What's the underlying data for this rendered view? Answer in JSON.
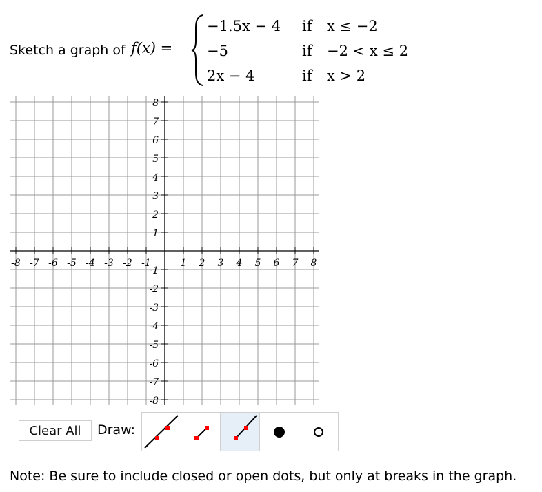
{
  "question": {
    "prompt": "Sketch a graph of",
    "function_label": "f(x) =",
    "cases": [
      {
        "expr": "−1.5x − 4",
        "if": "if",
        "cond": "x ≤ −2"
      },
      {
        "expr": "−5",
        "if": "if",
        "cond": "−2 < x ≤ 2"
      },
      {
        "expr": "2x − 4",
        "if": "if",
        "cond": "x > 2"
      }
    ]
  },
  "graph": {
    "x_range": [
      -8,
      8
    ],
    "y_range": [
      -8,
      8
    ],
    "x_ticks": [
      "-8",
      "-7",
      "-6",
      "-5",
      "-4",
      "-3",
      "-2",
      "-1",
      "1",
      "2",
      "3",
      "4",
      "5",
      "6",
      "7",
      "8"
    ],
    "y_ticks": [
      "8",
      "7",
      "6",
      "5",
      "4",
      "3",
      "2",
      "1",
      "-1",
      "-2",
      "-3",
      "-4",
      "-5",
      "-6",
      "-7",
      "-8"
    ],
    "grid_color": "#999999",
    "axis_color": "#000000"
  },
  "toolbar": {
    "clear_label": "Clear All",
    "draw_label": "Draw:",
    "tools": [
      {
        "name": "line",
        "icon": "line-icon",
        "selected": false
      },
      {
        "name": "segment",
        "icon": "segment-icon",
        "selected": false
      },
      {
        "name": "ray",
        "icon": "ray-icon",
        "selected": true
      },
      {
        "name": "closed-dot",
        "icon": "closed-dot-icon",
        "selected": false
      },
      {
        "name": "open-dot",
        "icon": "open-dot-icon",
        "selected": false
      }
    ],
    "selected_bg": "#e6eef8",
    "point_color": "#ff0000"
  },
  "note": "Note: Be sure to include closed or open dots, but only at breaks in the graph."
}
